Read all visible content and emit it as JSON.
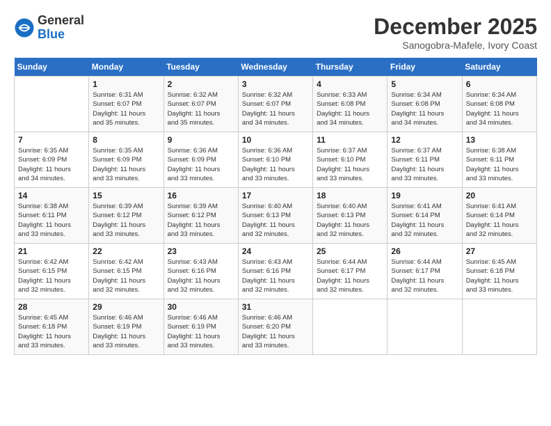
{
  "logo": {
    "general": "General",
    "blue": "Blue"
  },
  "title": "December 2025",
  "location": "Sanogobra-Mafele, Ivory Coast",
  "days_header": [
    "Sunday",
    "Monday",
    "Tuesday",
    "Wednesday",
    "Thursday",
    "Friday",
    "Saturday"
  ],
  "weeks": [
    [
      {
        "day": "",
        "info": ""
      },
      {
        "day": "1",
        "info": "Sunrise: 6:31 AM\nSunset: 6:07 PM\nDaylight: 11 hours\nand 35 minutes."
      },
      {
        "day": "2",
        "info": "Sunrise: 6:32 AM\nSunset: 6:07 PM\nDaylight: 11 hours\nand 35 minutes."
      },
      {
        "day": "3",
        "info": "Sunrise: 6:32 AM\nSunset: 6:07 PM\nDaylight: 11 hours\nand 34 minutes."
      },
      {
        "day": "4",
        "info": "Sunrise: 6:33 AM\nSunset: 6:08 PM\nDaylight: 11 hours\nand 34 minutes."
      },
      {
        "day": "5",
        "info": "Sunrise: 6:34 AM\nSunset: 6:08 PM\nDaylight: 11 hours\nand 34 minutes."
      },
      {
        "day": "6",
        "info": "Sunrise: 6:34 AM\nSunset: 6:08 PM\nDaylight: 11 hours\nand 34 minutes."
      }
    ],
    [
      {
        "day": "7",
        "info": "Sunrise: 6:35 AM\nSunset: 6:09 PM\nDaylight: 11 hours\nand 34 minutes."
      },
      {
        "day": "8",
        "info": "Sunrise: 6:35 AM\nSunset: 6:09 PM\nDaylight: 11 hours\nand 33 minutes."
      },
      {
        "day": "9",
        "info": "Sunrise: 6:36 AM\nSunset: 6:09 PM\nDaylight: 11 hours\nand 33 minutes."
      },
      {
        "day": "10",
        "info": "Sunrise: 6:36 AM\nSunset: 6:10 PM\nDaylight: 11 hours\nand 33 minutes."
      },
      {
        "day": "11",
        "info": "Sunrise: 6:37 AM\nSunset: 6:10 PM\nDaylight: 11 hours\nand 33 minutes."
      },
      {
        "day": "12",
        "info": "Sunrise: 6:37 AM\nSunset: 6:11 PM\nDaylight: 11 hours\nand 33 minutes."
      },
      {
        "day": "13",
        "info": "Sunrise: 6:38 AM\nSunset: 6:11 PM\nDaylight: 11 hours\nand 33 minutes."
      }
    ],
    [
      {
        "day": "14",
        "info": "Sunrise: 6:38 AM\nSunset: 6:11 PM\nDaylight: 11 hours\nand 33 minutes."
      },
      {
        "day": "15",
        "info": "Sunrise: 6:39 AM\nSunset: 6:12 PM\nDaylight: 11 hours\nand 33 minutes."
      },
      {
        "day": "16",
        "info": "Sunrise: 6:39 AM\nSunset: 6:12 PM\nDaylight: 11 hours\nand 33 minutes."
      },
      {
        "day": "17",
        "info": "Sunrise: 6:40 AM\nSunset: 6:13 PM\nDaylight: 11 hours\nand 32 minutes."
      },
      {
        "day": "18",
        "info": "Sunrise: 6:40 AM\nSunset: 6:13 PM\nDaylight: 11 hours\nand 32 minutes."
      },
      {
        "day": "19",
        "info": "Sunrise: 6:41 AM\nSunset: 6:14 PM\nDaylight: 11 hours\nand 32 minutes."
      },
      {
        "day": "20",
        "info": "Sunrise: 6:41 AM\nSunset: 6:14 PM\nDaylight: 11 hours\nand 32 minutes."
      }
    ],
    [
      {
        "day": "21",
        "info": "Sunrise: 6:42 AM\nSunset: 6:15 PM\nDaylight: 11 hours\nand 32 minutes."
      },
      {
        "day": "22",
        "info": "Sunrise: 6:42 AM\nSunset: 6:15 PM\nDaylight: 11 hours\nand 32 minutes."
      },
      {
        "day": "23",
        "info": "Sunrise: 6:43 AM\nSunset: 6:16 PM\nDaylight: 11 hours\nand 32 minutes."
      },
      {
        "day": "24",
        "info": "Sunrise: 6:43 AM\nSunset: 6:16 PM\nDaylight: 11 hours\nand 32 minutes."
      },
      {
        "day": "25",
        "info": "Sunrise: 6:44 AM\nSunset: 6:17 PM\nDaylight: 11 hours\nand 32 minutes."
      },
      {
        "day": "26",
        "info": "Sunrise: 6:44 AM\nSunset: 6:17 PM\nDaylight: 11 hours\nand 32 minutes."
      },
      {
        "day": "27",
        "info": "Sunrise: 6:45 AM\nSunset: 6:18 PM\nDaylight: 11 hours\nand 33 minutes."
      }
    ],
    [
      {
        "day": "28",
        "info": "Sunrise: 6:45 AM\nSunset: 6:18 PM\nDaylight: 11 hours\nand 33 minutes."
      },
      {
        "day": "29",
        "info": "Sunrise: 6:46 AM\nSunset: 6:19 PM\nDaylight: 11 hours\nand 33 minutes."
      },
      {
        "day": "30",
        "info": "Sunrise: 6:46 AM\nSunset: 6:19 PM\nDaylight: 11 hours\nand 33 minutes."
      },
      {
        "day": "31",
        "info": "Sunrise: 6:46 AM\nSunset: 6:20 PM\nDaylight: 11 hours\nand 33 minutes."
      },
      {
        "day": "",
        "info": ""
      },
      {
        "day": "",
        "info": ""
      },
      {
        "day": "",
        "info": ""
      }
    ]
  ]
}
